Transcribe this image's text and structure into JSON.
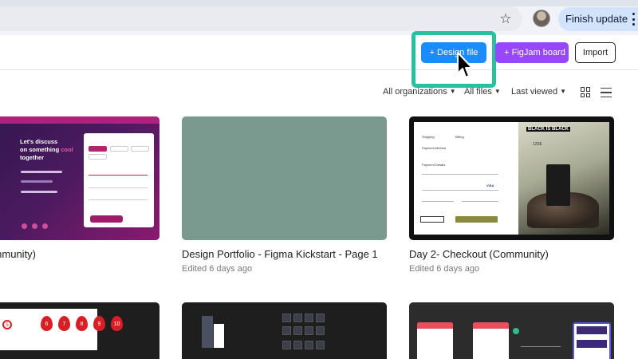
{
  "browser": {
    "finish_update_label": "Finish update",
    "star_icon": "star-icon",
    "menu_icon": "kebab-menu-icon"
  },
  "header": {
    "design_file_label": "+ Design file",
    "figjam_label": "+ FigJam board",
    "import_label": "Import"
  },
  "filters": {
    "organizations": "All organizations",
    "files": "All files",
    "sort": "Last viewed"
  },
  "files": [
    {
      "title": "orm UI (Community)",
      "subtitle": "ago",
      "thumb": {
        "headline_1": "Let's discuss",
        "headline_2": "on something",
        "headline_accent": "cool",
        "headline_3": "together"
      }
    },
    {
      "title": "Design Portfolio - Figma Kickstart - Page 1",
      "subtitle": "Edited 6 days ago"
    },
    {
      "title": "Day 2- Checkout (Community)",
      "subtitle": "Edited 6 days ago",
      "thumb": {
        "label_1": "Shipping",
        "label_2": "Billing",
        "label_3": "Payment Method",
        "label_4": "Payment Details",
        "label_5": "VISA",
        "brand": "BLACK IS BLACK",
        "price": "120$"
      }
    }
  ],
  "row2_numbers": [
    "5",
    "6",
    "7",
    "8",
    "9",
    "10"
  ],
  "colors": {
    "design_button": "#1a8cff",
    "figjam_button": "#9747ff",
    "highlight": "#27c1a0",
    "portfolio_thumb": "#7b9a8f"
  }
}
